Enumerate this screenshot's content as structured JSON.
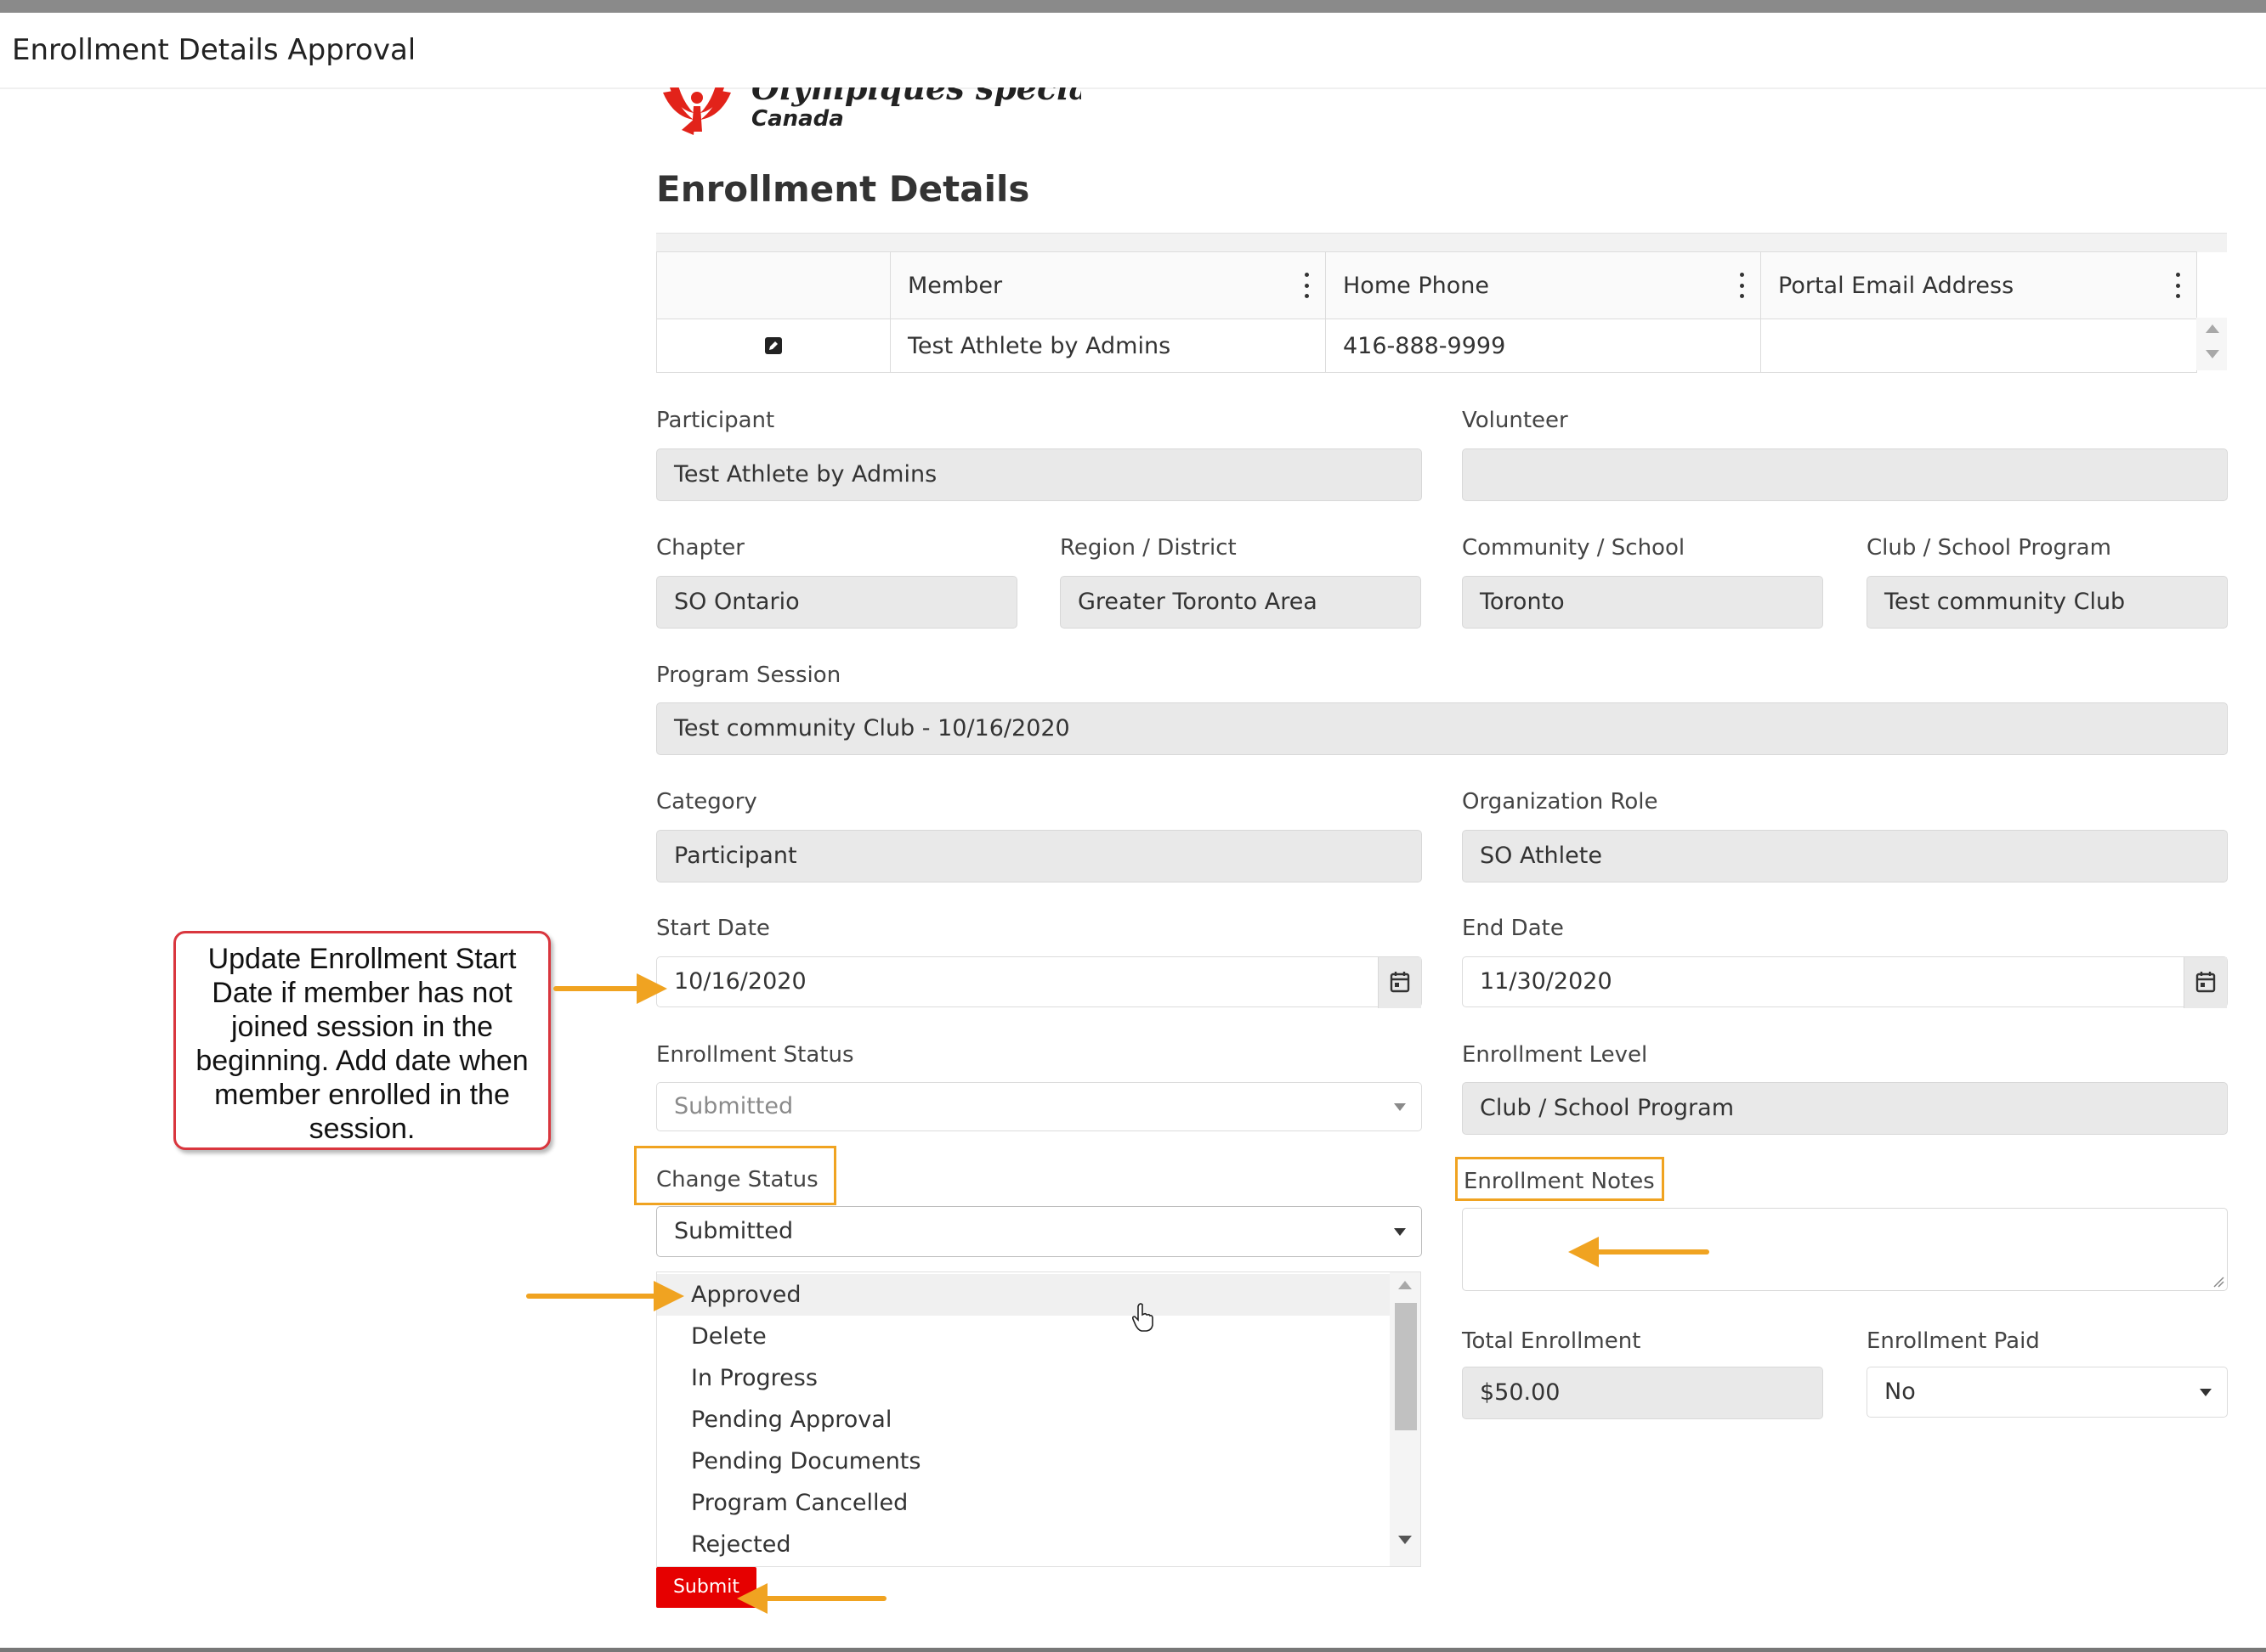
{
  "window": {
    "title": "Enrollment Details Approval"
  },
  "logo": {
    "line1": "Olympiques spéciaux",
    "line2": "Canada",
    "mark": "special-olympics-logo"
  },
  "page": {
    "heading": "Enrollment Details"
  },
  "grid": {
    "columns": [
      "Member",
      "Home Phone",
      "Portal Email Address"
    ],
    "rows": [
      {
        "member": "Test Athlete by Admins",
        "home_phone": "416-888-9999",
        "portal_email": ""
      }
    ]
  },
  "form": {
    "participant": {
      "label": "Participant",
      "value": "Test Athlete by Admins"
    },
    "volunteer": {
      "label": "Volunteer",
      "value": ""
    },
    "chapter": {
      "label": "Chapter",
      "value": "SO Ontario"
    },
    "region": {
      "label": "Region / District",
      "value": "Greater Toronto Area"
    },
    "community": {
      "label": "Community / School",
      "value": "Toronto"
    },
    "club": {
      "label": "Club / School Program",
      "value": "Test community Club"
    },
    "program_session": {
      "label": "Program Session",
      "value": "Test community Club - 10/16/2020"
    },
    "category": {
      "label": "Category",
      "value": "Participant"
    },
    "org_role": {
      "label": "Organization Role",
      "value": "SO Athlete"
    },
    "start_date": {
      "label": "Start Date",
      "value": "10/16/2020"
    },
    "end_date": {
      "label": "End Date",
      "value": "11/30/2020"
    },
    "enrollment_status": {
      "label": "Enrollment Status",
      "value": "Submitted"
    },
    "enrollment_level": {
      "label": "Enrollment Level",
      "value": "Club / School Program"
    },
    "change_status": {
      "label": "Change Status",
      "value": "Submitted",
      "options": [
        "Approved",
        "Delete",
        "In Progress",
        "Pending Approval",
        "Pending Documents",
        "Program Cancelled",
        "Rejected"
      ],
      "highlighted": "Approved"
    },
    "enrollment_notes": {
      "label": "Enrollment Notes",
      "value": ""
    },
    "total_enrollment": {
      "label": "Total Enrollment",
      "value": "$50.00"
    },
    "enrollment_paid": {
      "label": "Enrollment Paid",
      "value": "No"
    },
    "submit_label": "Submit"
  },
  "annotation": {
    "callout_text": "Update Enrollment Start Date if member has not joined session in the beginning. Add date when member enrolled in the session.",
    "highlight_color": "#f0a321",
    "callout_border_color": "#d9363e"
  },
  "colors": {
    "submit": "#e60000",
    "field_bg": "#e9e9e9"
  }
}
